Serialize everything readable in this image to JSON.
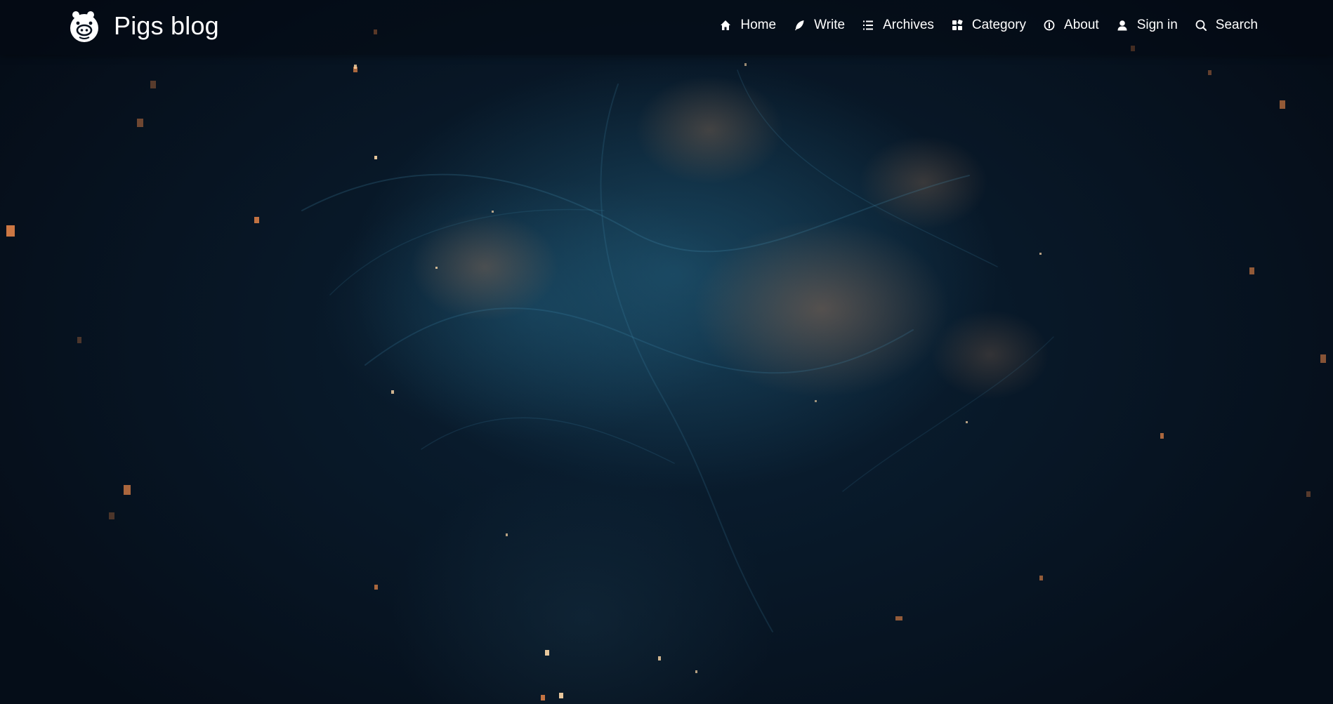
{
  "site": {
    "title": "Pigs blog",
    "logo_icon": "pig-face-icon"
  },
  "nav": {
    "items": [
      {
        "label": "Home",
        "icon": "home-icon"
      },
      {
        "label": "Write",
        "icon": "feather-icon"
      },
      {
        "label": "Archives",
        "icon": "list-icon"
      },
      {
        "label": "Category",
        "icon": "grid-icon"
      },
      {
        "label": "About",
        "icon": "info-icon"
      },
      {
        "label": "Sign in",
        "icon": "user-icon"
      },
      {
        "label": "Search",
        "icon": "search-icon"
      }
    ]
  },
  "theme": {
    "nav_text": "#ffffff",
    "background": "#06101c",
    "nebula_blue": "#26668a",
    "ember_orange": "#e0703a"
  }
}
